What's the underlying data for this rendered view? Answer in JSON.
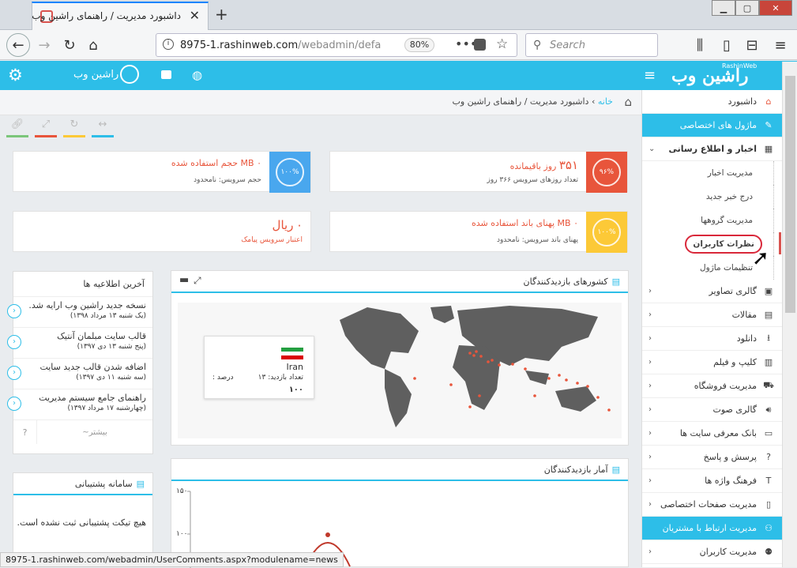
{
  "browser": {
    "tab_title": "داشبورد مدیریت / راهنمای راشین وب",
    "url_host": "8975-1.rashinweb.com",
    "url_path": "/webadmin/defa",
    "zoom": "80%",
    "search_placeholder": "Search"
  },
  "header": {
    "logo": "راشین وب",
    "logo_sub": "RashinWeb",
    "username": "راشین وب"
  },
  "breadcrumb": {
    "home": "خانه",
    "path": "داشبورد مدیریت / راهنمای راشین وب"
  },
  "sidebar": {
    "dashboard": "داشبورد",
    "special_modules": "ماژول های اختصاصی",
    "news": "اخبار و اطلاع رسانی",
    "news_sub": [
      "مدیریت اخبار",
      "درج خبر جدید",
      "مدیریت گروهها",
      "نظرات کاربران",
      "تنظیمات ماژول"
    ],
    "items": [
      "گالری تصاویر",
      "مقالات",
      "دانلود",
      "کلیپ و فیلم",
      "مدیریت فروشگاه",
      "گالری صوت",
      "بانک معرفی سایت ها",
      "پرسش و پاسخ",
      "فرهنگ واژه ها",
      "مدیریت صفحات اختصاصی"
    ],
    "crm": "مدیریت ارتباط با مشتریان",
    "users": "مدیریت کاربران"
  },
  "cards": {
    "volume": {
      "title": "MB حجم استفاده شده",
      "value": "۰",
      "sub": "حجم سرویس: نامحدود",
      "pct": "۱۰۰%"
    },
    "days": {
      "title": "روز باقیمانده",
      "value": "۳۵۱",
      "sub": "تعداد روزهای سرویس ۳۶۶ روز",
      "pct": "۹۶%"
    },
    "sms": {
      "title": "ریال",
      "value": "۰",
      "sub": "اعتبار سرویس پیامک"
    },
    "bandwidth": {
      "title": "MB پهنای باند استفاده شده",
      "value": "۰",
      "sub": "پهنای باند سرویس: نامحدود",
      "pct": "۱۰۰%"
    }
  },
  "announcements": {
    "title": "آخرین اطلاعیه ها",
    "items": [
      {
        "title": "نسخه جدید راشین وب ارایه شد.",
        "date": "(یک شنبه ۱۳ مرداد ۱۳۹۸)"
      },
      {
        "title": "قالب سایت مبلمان آنتیک",
        "date": "(پنج شنبه ۱۳ دی ۱۳۹۷)"
      },
      {
        "title": "اضافه شدن قالب جدید سایت",
        "date": "(سه شنبه ۱۱ دی ۱۳۹۷)"
      },
      {
        "title": "راهنمای جامع سیستم مدیریت",
        "date": "(چهارشنبه ۱۷ مرداد ۱۳۹۷)"
      }
    ],
    "more": "بیشتر~"
  },
  "map_panel": {
    "title": "کشورهای بازدیدکنندگان",
    "country": "Iran",
    "visits_label": "تعداد بازدید: ۱۳",
    "pct_label": "درصد :",
    "total": "۱۰۰"
  },
  "stats_panel": {
    "title": "آمار بازدیدکنندگان",
    "y150": "۱۵۰",
    "y100": "۱۰۰"
  },
  "support": {
    "title": "سامانه پشتیبانی",
    "empty": "هیچ تیکت پشتیبانی ثبت نشده است."
  },
  "status_url": "8975-1.rashinweb.com/webadmin/UserComments.aspx?modulename=news",
  "colors": {
    "accent": "#2dbee8",
    "danger": "#e8553b",
    "blue": "#49a7ee",
    "yellow": "#fcc937"
  }
}
